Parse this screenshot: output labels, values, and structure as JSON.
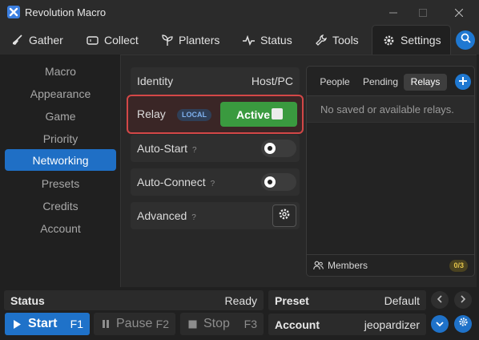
{
  "window": {
    "title": "Revolution Macro"
  },
  "tabs": [
    {
      "label": "Gather",
      "icon": "broom-icon"
    },
    {
      "label": "Collect",
      "icon": "ticket-icon"
    },
    {
      "label": "Planters",
      "icon": "sprout-icon"
    },
    {
      "label": "Status",
      "icon": "pulse-icon"
    },
    {
      "label": "Tools",
      "icon": "wrench-icon"
    },
    {
      "label": "Settings",
      "icon": "gear-icon"
    }
  ],
  "active_tab": "Settings",
  "sidebar": {
    "items": [
      "Macro",
      "Appearance",
      "Game",
      "Priority",
      "Networking",
      "Presets",
      "Credits",
      "Account"
    ],
    "active": "Networking"
  },
  "networking": {
    "identity": {
      "label": "Identity",
      "value": "Host/PC"
    },
    "relay": {
      "label": "Relay",
      "badge": "LOCAL",
      "button_label": "Active",
      "checked": false
    },
    "auto_start": {
      "label": "Auto-Start",
      "help": "?",
      "enabled": false
    },
    "auto_connect": {
      "label": "Auto-Connect",
      "help": "?",
      "enabled": false
    },
    "advanced": {
      "label": "Advanced",
      "help": "?"
    }
  },
  "relays_panel": {
    "tabs": [
      "People",
      "Pending",
      "Relays"
    ],
    "active_tab": "Relays",
    "empty_message": "No saved or available relays.",
    "members_label": "Members",
    "members_count": "0/3"
  },
  "bottom": {
    "status_label": "Status",
    "status_value": "Ready",
    "preset_label": "Preset",
    "preset_value": "Default",
    "account_label": "Account",
    "account_value": "jeopardizer",
    "start": {
      "label": "Start",
      "key": "F1"
    },
    "pause": {
      "label": "Pause",
      "key": "F2"
    },
    "stop": {
      "label": "Stop",
      "key": "F3"
    }
  },
  "colors": {
    "accent": "#1f78d1",
    "active_green": "#3a9a3f",
    "highlight_red": "#d34747"
  }
}
